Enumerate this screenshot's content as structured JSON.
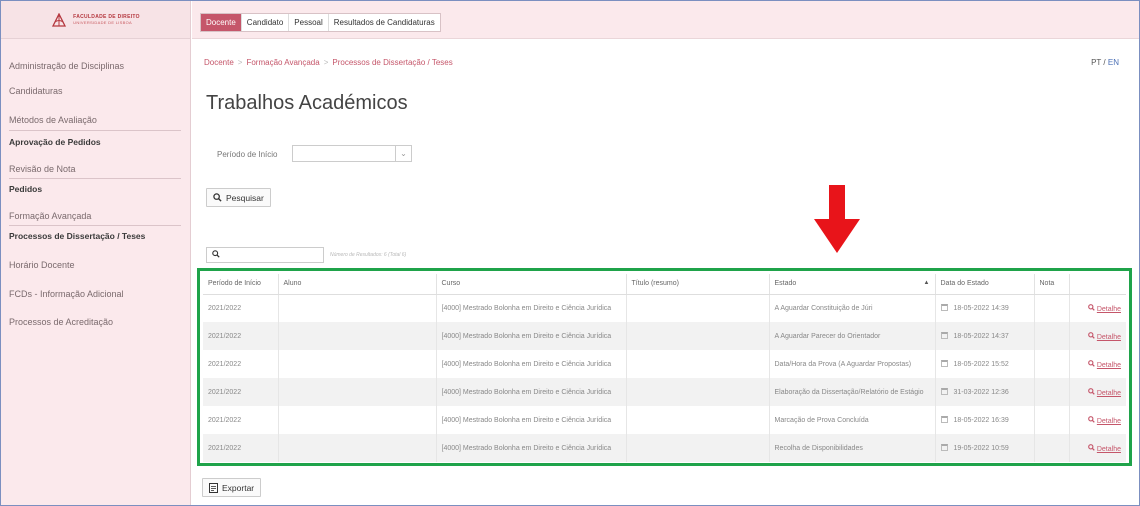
{
  "logo": {
    "line1": "FACULDADE DE DIREITO",
    "line2": "UNIVERSIDADE DE LISBOA"
  },
  "sidebar": {
    "items": [
      {
        "label": "Administração de Disciplinas"
      },
      {
        "label": "Candidaturas"
      },
      {
        "label": "Métodos de Avaliação"
      },
      {
        "label": "Aprovação de Pedidos"
      },
      {
        "label": "Revisão de Nota"
      },
      {
        "label": "Pedidos"
      },
      {
        "label": "Formação Avançada"
      },
      {
        "label": "Processos de Dissertação / Teses"
      },
      {
        "label": "Horário Docente"
      },
      {
        "label": "FCDs - Informação Adicional"
      },
      {
        "label": "Processos de Acreditação"
      }
    ]
  },
  "topbar": {
    "tabs": [
      {
        "label": "Docente"
      },
      {
        "label": "Candidato"
      },
      {
        "label": "Pessoal"
      },
      {
        "label": "Resultados de Candidaturas"
      }
    ]
  },
  "breadcrumb": {
    "items": [
      "Docente",
      "Formação Avançada",
      "Processos de Dissertação / Teses"
    ],
    "separator": ">"
  },
  "lang": {
    "current": "PT",
    "divider": "/",
    "alt": "EN"
  },
  "page_title": "Trabalhos Académicos",
  "filter": {
    "label": "Período de Início",
    "value": "",
    "caret": "⌄"
  },
  "search_button": {
    "label": "Pesquisar"
  },
  "search_box": {
    "value": "",
    "hint": "Número de Resultados: 6 (Total 6)"
  },
  "table": {
    "headers": [
      "Período de Início",
      "Aluno",
      "Curso",
      "Título (resumo)",
      "Estado",
      "Data do Estado",
      "Nota",
      ""
    ],
    "sort_indicator": "▲",
    "detail_label": "Detalhe",
    "rows": [
      {
        "periodo": "2021/2022",
        "aluno": "",
        "curso": "[4000] Mestrado Bolonha em Direito e Ciência Jurídica",
        "titulo": "",
        "estado": "A Aguardar Constituição de Júri",
        "data": "18-05-2022 14:39",
        "nota": ""
      },
      {
        "periodo": "2021/2022",
        "aluno": "",
        "curso": "[4000] Mestrado Bolonha em Direito e Ciência Jurídica",
        "titulo": "",
        "estado": "A Aguardar Parecer do Orientador",
        "data": "18-05-2022 14:37",
        "nota": ""
      },
      {
        "periodo": "2021/2022",
        "aluno": "",
        "curso": "[4000] Mestrado Bolonha em Direito e Ciência Jurídica",
        "titulo": "",
        "estado": "Data/Hora da Prova (A Aguardar Propostas)",
        "data": "18-05-2022 15:52",
        "nota": ""
      },
      {
        "periodo": "2021/2022",
        "aluno": "",
        "curso": "[4000] Mestrado Bolonha em Direito e Ciência Jurídica",
        "titulo": "",
        "estado": "Elaboração da Dissertação/Relatório de Estágio",
        "data": "31-03-2022 12:36",
        "nota": ""
      },
      {
        "periodo": "2021/2022",
        "aluno": "",
        "curso": "[4000] Mestrado Bolonha em Direito e Ciência Jurídica",
        "titulo": "",
        "estado": "Marcação de Prova Concluída",
        "data": "18-05-2022 16:39",
        "nota": ""
      },
      {
        "periodo": "2021/2022",
        "aluno": "",
        "curso": "[4000] Mestrado Bolonha em Direito e Ciência Jurídica",
        "titulo": "",
        "estado": "Recolha de Disponibilidades",
        "data": "19-05-2022 10:59",
        "nota": ""
      }
    ]
  },
  "export_button": {
    "label": "Exportar"
  },
  "colors": {
    "accent": "#c5566a",
    "sidebar_bg": "#fbe9ec",
    "highlight_frame": "#1fa34a",
    "arrow": "#e8141a"
  }
}
